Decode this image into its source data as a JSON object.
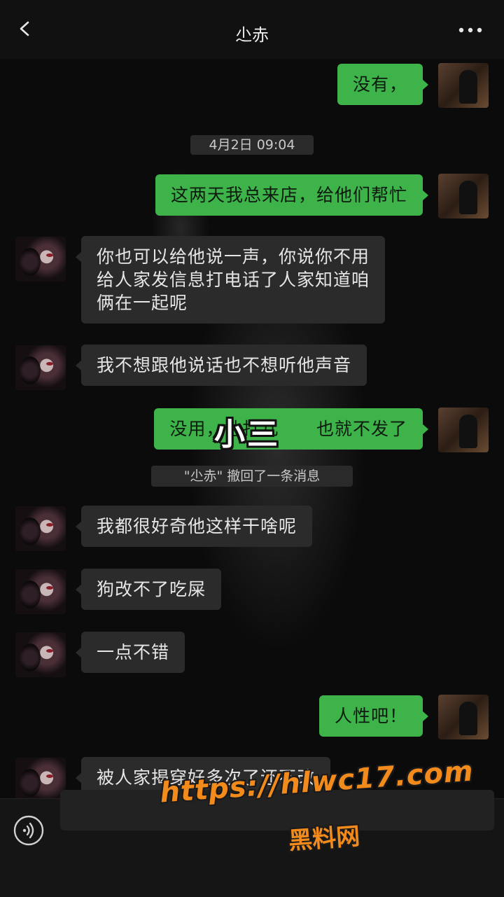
{
  "header": {
    "title": "尐赤",
    "back_icon": "chevron-left-icon",
    "more_icon": "ellipsis-icon"
  },
  "messages": [
    {
      "sender": "me",
      "text": "没有，"
    },
    {
      "sender": "me",
      "text": "这两天我总来店，给他们帮忙"
    },
    {
      "sender": "other",
      "text": "你也可以给他说一声，你说你不用\n给人家发信息打电话了人家知道咱\n俩在一起呢"
    },
    {
      "sender": "other",
      "text": "我不想跟他说话也不想听他声音"
    },
    {
      "sender": "me",
      "text": "没用，他打几      也就不发了"
    },
    {
      "sender": "other",
      "text": "我都很好奇他这样干啥呢"
    },
    {
      "sender": "other",
      "text": "狗改不了吃屎"
    },
    {
      "sender": "other",
      "text": "一点不错"
    },
    {
      "sender": "me",
      "text": "人性吧！"
    },
    {
      "sender": "other",
      "text": "被人家揭穿好多次了还不改"
    }
  ],
  "timestamp": "4月2日 09:04",
  "recall_notice": "\"尐赤\" 撤回了一条消息",
  "overlay_caption": "小三",
  "watermark": {
    "url": "https://hlwc17.com",
    "site_name": "黑料网",
    "color": "#f28a1c"
  },
  "colors": {
    "my_bubble": "#3db34a",
    "other_bubble": "#2b2b2b",
    "background": "#0b0b0b"
  },
  "bottom_bar": {
    "voice_icon": "voice-icon"
  }
}
